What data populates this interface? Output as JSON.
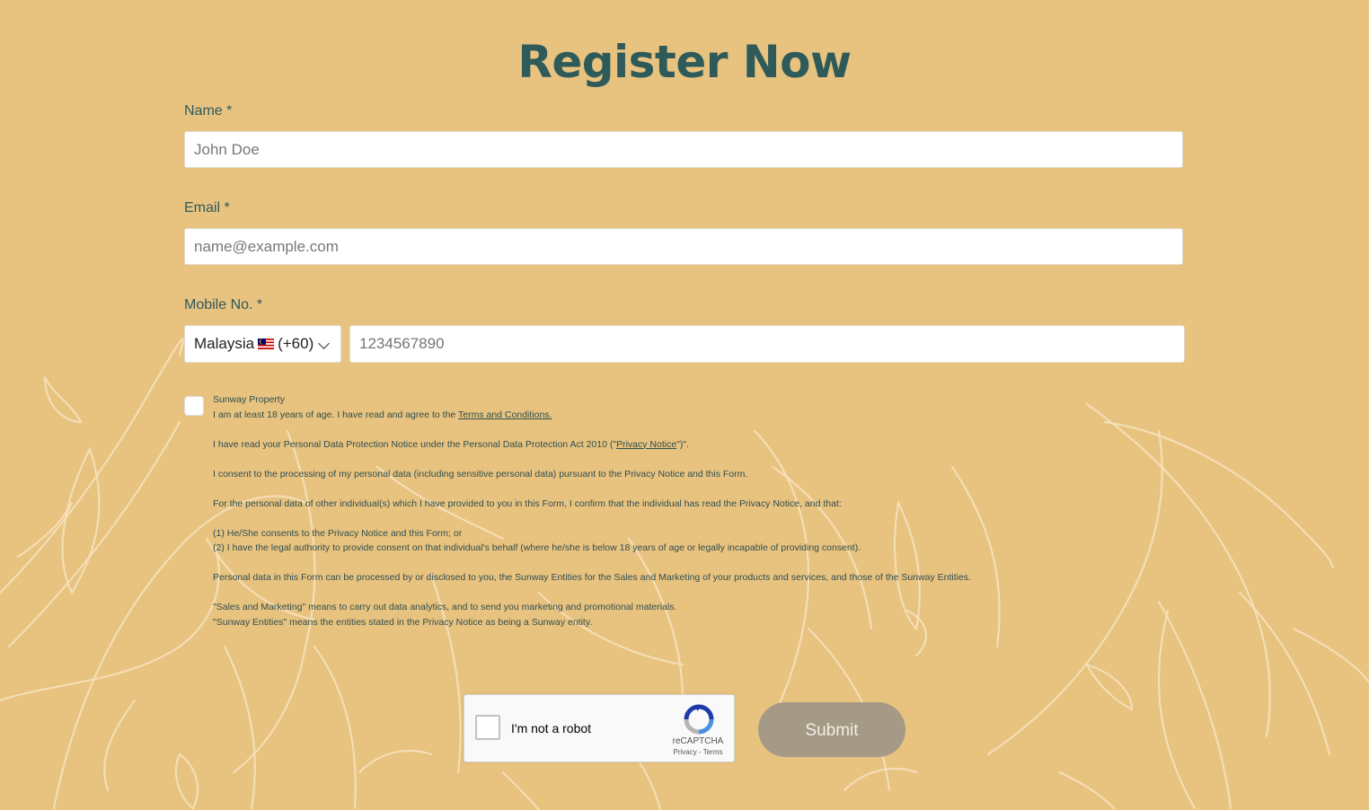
{
  "page": {
    "title": "Register Now"
  },
  "form": {
    "name": {
      "label": "Name *",
      "placeholder": "John Doe"
    },
    "email": {
      "label": "Email *",
      "placeholder": "name@example.com"
    },
    "mobile": {
      "label": "Mobile No. *",
      "country": "Malaysia",
      "dial_code": "(+60)",
      "placeholder": "1234567890"
    }
  },
  "consent": {
    "company": "Sunway Property",
    "line1": "I am at least 18 years of age. I have read and agree to the ",
    "line1_link": "Terms and Conditions.",
    "line2_pre": "I have read your Personal Data Protection Notice under the Personal Data Protection Act 2010 (\"",
    "line2_link": "Privacy Notice",
    "line2_post": "\")\".",
    "line3": "I consent to the processing of my personal data (including sensitive personal data) pursuant to the Privacy Notice and this Form.",
    "line4": "For the personal data of other individual(s) which I have provided to you in this Form, I confirm that the individual has read the Privacy Notice, and that:",
    "line5": "(1) He/She consents to the Privacy Notice and this Form; or",
    "line6": "(2) I have the legal authority to provide consent on that individual's behalf (where he/she is below 18 years of age or legally incapable of providing consent).",
    "line7": "Personal data in this Form can be processed by or disclosed to you, the Sunway Entities for the Sales and Marketing of your products and services, and those of the Sunway Entities.",
    "line8": "\"Sales and Marketing\" means to carry out data analytics, and to send you marketing and promotional materials.",
    "line9": "\"Sunway Entities\" means the entities stated in the Privacy Notice as being a Sunway entity."
  },
  "captcha": {
    "label": "I'm not a robot",
    "brand": "reCAPTCHA",
    "links": "Privacy - Terms"
  },
  "submit_label": "Submit",
  "colors": {
    "background": "#e8c27f",
    "heading": "#2f5a5a",
    "submit_bg": "#a59a86"
  }
}
